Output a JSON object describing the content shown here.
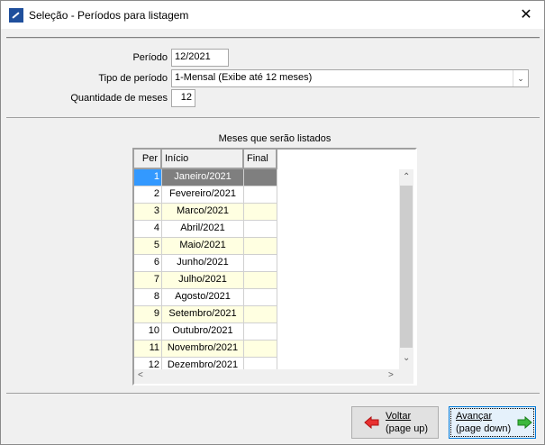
{
  "window": {
    "title": "Seleção - Períodos para listagem",
    "close": "✕"
  },
  "form": {
    "periodo_label": "Período",
    "periodo_value": "12/2021",
    "tipo_label": "Tipo de período",
    "tipo_value": "1-Mensal (Exibe até 12 meses)",
    "qtd_label": "Quantidade de meses",
    "qtd_value": "12"
  },
  "grid": {
    "title": "Meses que serão listados",
    "columns": [
      "Per",
      "Início",
      "Final"
    ],
    "rows": [
      {
        "per": "1",
        "inicio": "Janeiro/2021",
        "final": ""
      },
      {
        "per": "2",
        "inicio": "Fevereiro/2021",
        "final": ""
      },
      {
        "per": "3",
        "inicio": "Marco/2021",
        "final": ""
      },
      {
        "per": "4",
        "inicio": "Abril/2021",
        "final": ""
      },
      {
        "per": "5",
        "inicio": "Maio/2021",
        "final": ""
      },
      {
        "per": "6",
        "inicio": "Junho/2021",
        "final": ""
      },
      {
        "per": "7",
        "inicio": "Julho/2021",
        "final": ""
      },
      {
        "per": "8",
        "inicio": "Agosto/2021",
        "final": ""
      },
      {
        "per": "9",
        "inicio": "Setembro/2021",
        "final": ""
      },
      {
        "per": "10",
        "inicio": "Outubro/2021",
        "final": ""
      },
      {
        "per": "11",
        "inicio": "Novembro/2021",
        "final": ""
      },
      {
        "per": "12",
        "inicio": "Dezembro/2021",
        "final": ""
      }
    ]
  },
  "buttons": {
    "back_line1": "Voltar",
    "back_line2": "(page up)",
    "next_line1": "Avançar",
    "next_line2": "(page down)"
  },
  "colors": {
    "selected": "#3399ff",
    "alt_row": "#ffffe1",
    "back_arrow": "#e83030",
    "next_arrow": "#3cb83c"
  }
}
